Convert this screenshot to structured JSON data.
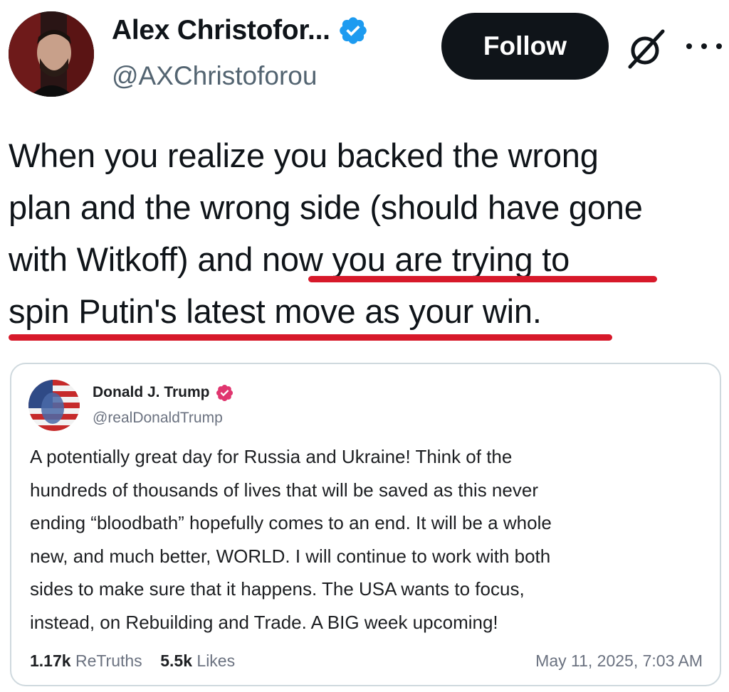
{
  "author": {
    "display_name": "Alex Christofor...",
    "handle": "@AXChristoforou",
    "verified": true,
    "verified_color": "#1d9bf0"
  },
  "header": {
    "follow_label": "Follow",
    "grok_icon": "grok-slash-icon",
    "more_icon": "more-horizontal-icon"
  },
  "tweet": {
    "lines": [
      "When you realize you backed the wrong",
      "plan and the wrong side (should have gone",
      "with Witkoff) and now you are trying to",
      "spin Putin's latest move as your win."
    ],
    "highlight_color": "#d7192a"
  },
  "quoted_post": {
    "display_name": "Donald J. Trump",
    "handle": "@realDonaldTrump",
    "verified_color": "#e0366f",
    "lines": [
      "A potentially great day for Russia and Ukraine! Think of the",
      "hundreds of thousands of lives that will be saved as this never",
      "ending “bloodbath” hopefully comes to an end. It will be a whole",
      "new, and much better, WORLD. I will continue to work with both",
      "sides to make sure that it happens. The USA wants to focus,",
      "instead, on Rebuilding and Trade. A BIG week upcoming!"
    ],
    "retruths_count": "1.17k",
    "retruths_label": "ReTruths",
    "likes_count": "5.5k",
    "likes_label": "Likes",
    "timestamp": "May 11, 2025, 7:03 AM"
  }
}
